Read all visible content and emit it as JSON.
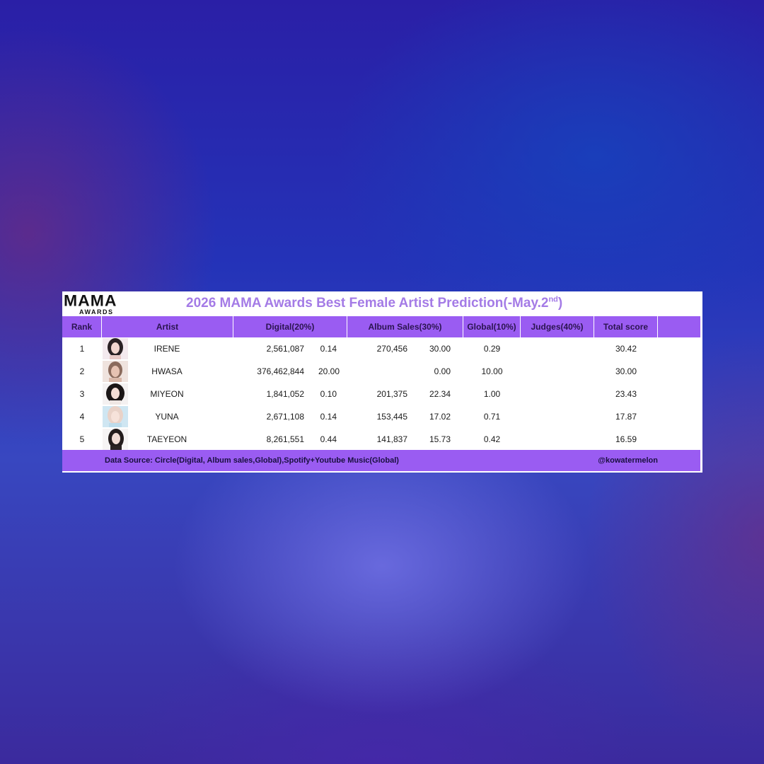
{
  "logo": {
    "main": "MAMA",
    "sub": "AWARDS"
  },
  "title": {
    "text": "2026 MAMA Awards Best Female Artist Prediction(-May.2",
    "sup": "nd",
    "suffix": ")"
  },
  "columns": {
    "rank": "Rank",
    "artist": "Artist",
    "digital": "Digital(20%)",
    "album": "Album Sales(30%)",
    "global": "Global(10%)",
    "judges": "Judges(40%)",
    "total": "Total score"
  },
  "rows": [
    {
      "rank": "1",
      "artist": "IRENE",
      "digital_value": "2,561,087",
      "digital_score": "0.14",
      "album_value": "270,456",
      "album_score": "30.00",
      "global": "0.29",
      "judges": "",
      "total": "30.42"
    },
    {
      "rank": "2",
      "artist": "HWASA",
      "digital_value": "376,462,844",
      "digital_score": "20.00",
      "album_value": "",
      "album_score": "0.00",
      "global": "10.00",
      "judges": "",
      "total": "30.00"
    },
    {
      "rank": "3",
      "artist": "MIYEON",
      "digital_value": "1,841,052",
      "digital_score": "0.10",
      "album_value": "201,375",
      "album_score": "22.34",
      "global": "1.00",
      "judges": "",
      "total": "23.43"
    },
    {
      "rank": "4",
      "artist": "YUNA",
      "digital_value": "2,671,108",
      "digital_score": "0.14",
      "album_value": "153,445",
      "album_score": "17.02",
      "global": "0.71",
      "judges": "",
      "total": "17.87"
    },
    {
      "rank": "5",
      "artist": "TAEYEON",
      "digital_value": "8,261,551",
      "digital_score": "0.44",
      "album_value": "141,837",
      "album_score": "15.73",
      "global": "0.42",
      "judges": "",
      "total": "16.59"
    }
  ],
  "footer": {
    "source": "Data Source: Circle(Digital, Album sales,Global),Spotify+Youtube Music(Global)",
    "handle": "@kowatermelon"
  },
  "colors": {
    "accent": "#9a5cf2",
    "title": "#a47be6"
  }
}
